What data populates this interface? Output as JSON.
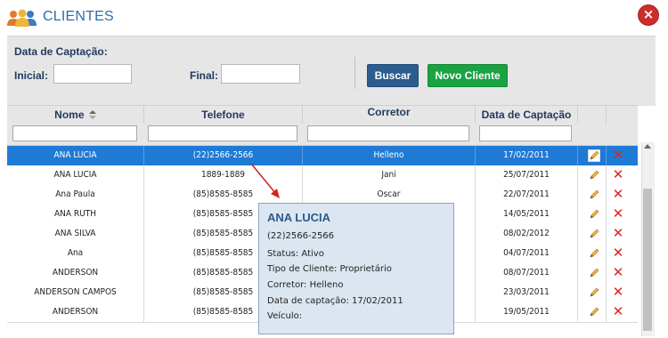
{
  "dialog": {
    "title": "CLIENTES",
    "close_glyph": "×"
  },
  "filters": {
    "heading": "Data de Captação:",
    "initial_label": "Inicial:",
    "final_label": "Final:",
    "initial_value": "",
    "final_value": "",
    "search_button": "Buscar",
    "new_client_button": "Novo Cliente"
  },
  "colors": {
    "accent": "#2f6ca8",
    "selected_row": "#1f7ad6",
    "search_btn": "#2c5d8e",
    "new_btn": "#1aa243",
    "delete": "#dd2222"
  },
  "table": {
    "headers": {
      "nome": "Nome",
      "telefone": "Telefone",
      "corretor": "Corretor",
      "data": "Data de Captação"
    },
    "sort_indicator": "nome-ascending",
    "rows": [
      {
        "nome": "ANA LUCIA",
        "telefone": "(22)2566-2566",
        "corretor": "Helleno",
        "data": "17/02/2011"
      },
      {
        "nome": "ANA LUCIA",
        "telefone": "1889-1889",
        "corretor": "Jani",
        "data": "25/07/2011"
      },
      {
        "nome": "Ana Paula",
        "telefone": "(85)8585-8585",
        "corretor": "Oscar",
        "data": "22/07/2011"
      },
      {
        "nome": "ANA RUTH",
        "telefone": "(85)8585-8585",
        "corretor": "",
        "data": "14/05/2011"
      },
      {
        "nome": "ANA SILVA",
        "telefone": "(85)8585-8585",
        "corretor": "",
        "data": "08/02/2012"
      },
      {
        "nome": "Ana",
        "telefone": "(85)8585-8585",
        "corretor": "",
        "data": "04/07/2011"
      },
      {
        "nome": "ANDERSON",
        "telefone": "(85)8585-8585",
        "corretor": "",
        "data": "08/07/2011"
      },
      {
        "nome": "ANDERSON CAMPOS",
        "telefone": "(85)8585-8585",
        "corretor": "",
        "data": "23/03/2011"
      },
      {
        "nome": "ANDERSON",
        "telefone": "(85)8585-8585",
        "corretor": "",
        "data": "19/05/2011"
      }
    ],
    "row_icons": {
      "edit": "pencil-icon",
      "delete": "x-icon"
    }
  },
  "tooltip": {
    "name": "ANA LUCIA",
    "phone": "(22)2566-2566",
    "status": "Status: Ativo",
    "tipo": "Tipo de Cliente: Proprietário",
    "corretor": "Corretor: Helleno",
    "data": "Data de captação: 17/02/2011",
    "veiculo": "Veículo:"
  }
}
